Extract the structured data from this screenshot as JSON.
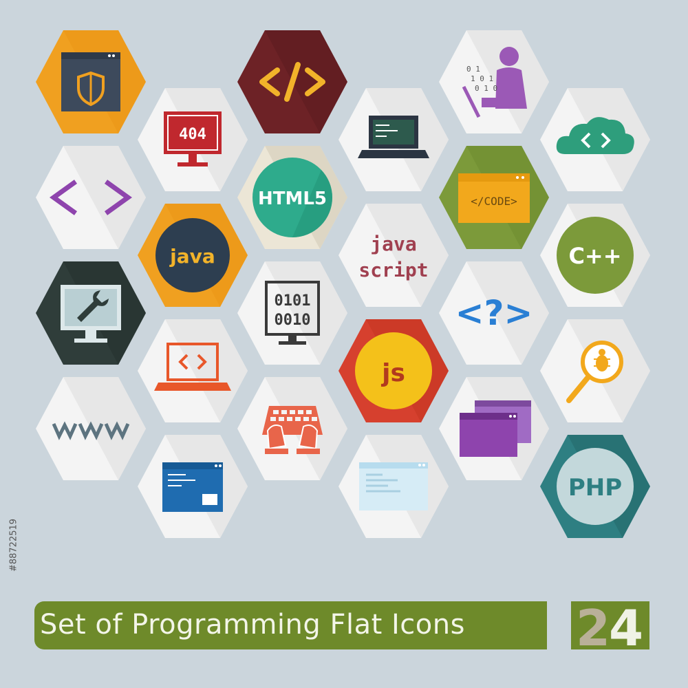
{
  "title": "Set of Programming Flat Icons",
  "count": "24",
  "stock_id": "#88722519",
  "colors": {
    "background": "#cbd5dc",
    "banner": "#6e8a2a",
    "banner_text": "#f3f5e8",
    "count_dark": "#4c6320",
    "count_light": "#b9b098"
  },
  "icons": [
    {
      "name": "browser-shield-icon",
      "label": ""
    },
    {
      "name": "code-brackets-dark-icon",
      "label": ""
    },
    {
      "name": "coder-binary-icon",
      "label": ""
    },
    {
      "name": "monitor-404-icon",
      "label": "404"
    },
    {
      "name": "laptop-code-icon",
      "label": ""
    },
    {
      "name": "cloud-code-icon",
      "label": ""
    },
    {
      "name": "angle-brackets-icon",
      "label": ""
    },
    {
      "name": "html5-badge-icon",
      "label": "HTML5"
    },
    {
      "name": "code-window-icon",
      "label": "</CODE>"
    },
    {
      "name": "java-badge-icon",
      "label": "java"
    },
    {
      "name": "javascript-text-icon",
      "label": "java script"
    },
    {
      "name": "cpp-badge-icon",
      "label": "C++"
    },
    {
      "name": "monitor-wrench-icon",
      "label": ""
    },
    {
      "name": "monitor-binary-icon",
      "label": "0101 0010"
    },
    {
      "name": "question-brackets-icon",
      "label": "<?>"
    },
    {
      "name": "laptop-brackets-icon",
      "label": ""
    },
    {
      "name": "js-badge-icon",
      "label": "js"
    },
    {
      "name": "bug-search-icon",
      "label": ""
    },
    {
      "name": "www-icon",
      "label": "www"
    },
    {
      "name": "keyboard-hands-icon",
      "label": ""
    },
    {
      "name": "windows-stack-icon",
      "label": ""
    },
    {
      "name": "browser-code-icon",
      "label": ""
    },
    {
      "name": "browser-lines-icon",
      "label": ""
    },
    {
      "name": "php-badge-icon",
      "label": "PHP"
    }
  ]
}
